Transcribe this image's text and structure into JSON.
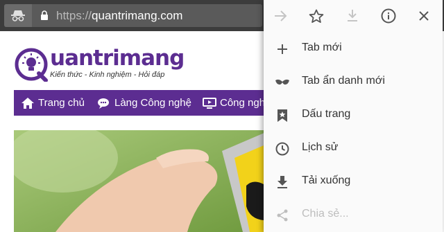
{
  "browser": {
    "url_scheme": "https://",
    "url_host": "quantrimang.com"
  },
  "site": {
    "logo_text": "uantrimang",
    "tagline": "Kiến thức - Kinh nghiệm - Hỏi đáp",
    "brand_color": "#5c2d91",
    "nav": [
      {
        "label": "Trang chủ",
        "icon": "home-icon"
      },
      {
        "label": "Làng Công nghệ",
        "icon": "chat-icon"
      },
      {
        "label": "Công nghệ",
        "icon": "monitor-icon"
      }
    ]
  },
  "menu": {
    "toolbar_icons": [
      "forward-icon",
      "bookmark-star-icon",
      "download-page-icon",
      "info-icon",
      "close-icon"
    ],
    "items": [
      {
        "label": "Tab mới",
        "icon": "plus-icon"
      },
      {
        "label": "Tab ẩn danh mới",
        "icon": "incognito-icon"
      },
      {
        "label": "Dấu trang",
        "icon": "bookmarks-icon"
      },
      {
        "label": "Lịch sử",
        "icon": "history-icon"
      },
      {
        "label": "Tải xuống",
        "icon": "download-icon"
      },
      {
        "label": "Chia sẻ...",
        "icon": "share-icon"
      }
    ]
  }
}
